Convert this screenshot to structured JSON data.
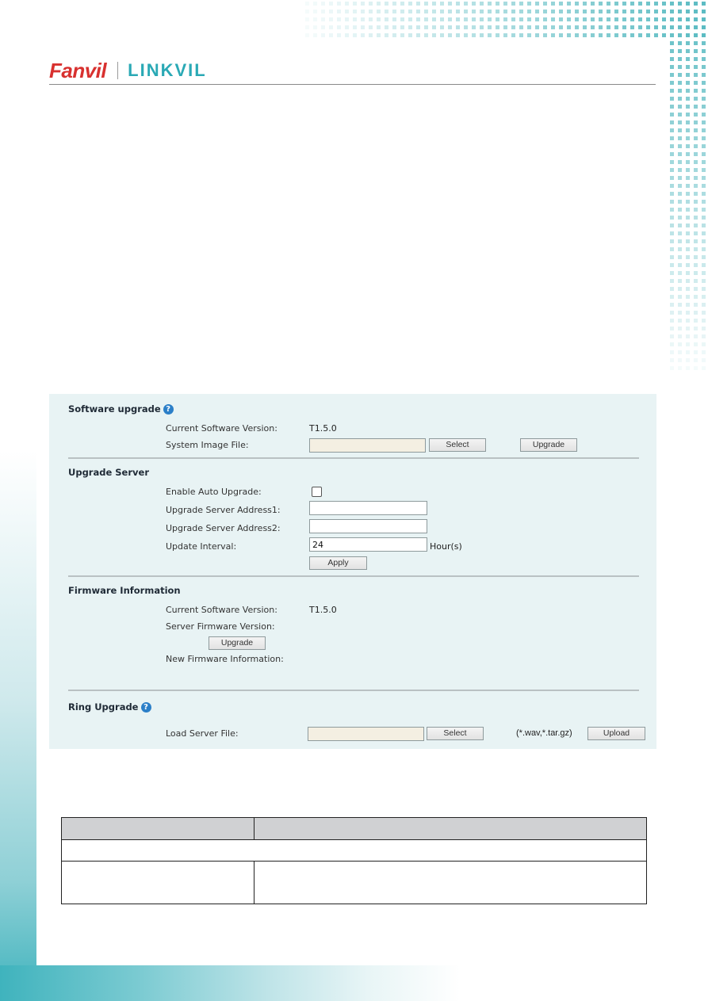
{
  "header": {
    "brand_primary": "Fanvil",
    "brand_secondary": "LINKVIL",
    "brand_primary_color": "#d8312f",
    "brand_secondary_color": "#2aa9b5"
  },
  "panel": {
    "software_upgrade": {
      "title": "Software upgrade",
      "help_icon": "help-icon",
      "current_version_label": "Current Software Version:",
      "current_version_value": "T1.5.0",
      "image_file_label": "System Image File:",
      "image_file_value": "",
      "select_label": "Select",
      "upgrade_label": "Upgrade"
    },
    "upgrade_server": {
      "title": "Upgrade Server",
      "enable_auto_label": "Enable Auto Upgrade:",
      "enable_auto_checked": false,
      "address1_label": "Upgrade Server Address1:",
      "address1_value": "",
      "address2_label": "Upgrade Server Address2:",
      "address2_value": "",
      "interval_label": "Update Interval:",
      "interval_value": "24",
      "interval_unit": "Hour(s)",
      "apply_label": "Apply"
    },
    "firmware_information": {
      "title": "Firmware Information",
      "current_version_label": "Current Software Version:",
      "current_version_value": "T1.5.0",
      "server_version_label": "Server Firmware Version:",
      "server_version_value": "",
      "upgrade_label": "Upgrade",
      "new_info_label": "New Firmware Information:",
      "new_info_value": ""
    },
    "ring_upgrade": {
      "title": "Ring Upgrade",
      "help_icon": "help-icon",
      "load_file_label": "Load Server File:",
      "load_file_value": "",
      "select_label": "Select",
      "file_types": "(*.wav,*.tar.gz)",
      "upload_label": "Upload"
    }
  },
  "doc_table": {
    "header": [
      "",
      ""
    ],
    "full_row": "",
    "rows": [
      [
        "",
        ""
      ]
    ]
  }
}
